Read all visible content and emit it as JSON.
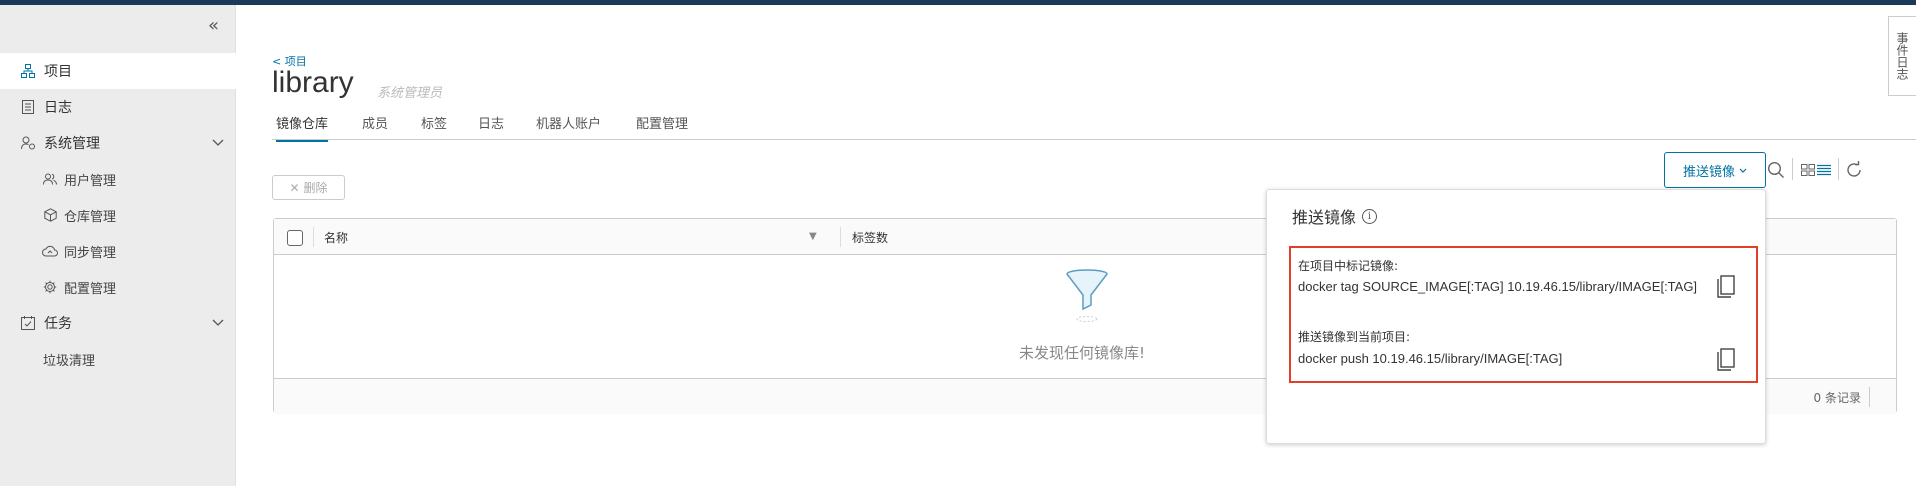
{
  "sidebar": {
    "items": [
      {
        "label": "项目",
        "icon": "project-icon"
      },
      {
        "label": "日志",
        "icon": "log-icon"
      },
      {
        "label": "系统管理",
        "icon": "admin-icon"
      },
      {
        "label": "任务",
        "icon": "task-icon"
      }
    ],
    "admin_sub": [
      {
        "label": "用户管理",
        "icon": "users-icon"
      },
      {
        "label": "仓库管理",
        "icon": "cube-icon"
      },
      {
        "label": "同步管理",
        "icon": "cloud-icon"
      },
      {
        "label": "配置管理",
        "icon": "gear-icon"
      }
    ],
    "task_sub": [
      {
        "label": "垃圾清理"
      }
    ]
  },
  "header": {
    "breadcrumb": "< 项目",
    "title": "library",
    "role": "系统管理员"
  },
  "tabs": [
    "镜像仓库",
    "成员",
    "标签",
    "日志",
    "机器人账户",
    "配置管理"
  ],
  "toolbar": {
    "delete_label": "删除",
    "push_label": "推送镜像"
  },
  "grid": {
    "columns": [
      "名称",
      "标签数"
    ],
    "empty_text": "未发现任何镜像库!",
    "record_count": "0 条记录"
  },
  "popover": {
    "title": "推送镜像",
    "tag_label": "在项目中标记镜像:",
    "tag_command": "docker tag SOURCE_IMAGE[:TAG] 10.19.46.15/library/IMAGE[:TAG]",
    "push_label": "推送镜像到当前项目:",
    "push_command": "docker push 10.19.46.15/library/IMAGE[:TAG]"
  },
  "side_tab": "事件日志",
  "colors": {
    "accent": "#0072a3",
    "highlight_border": "#e0402a",
    "topbar": "#1b3a57",
    "sidebar_bg": "#ececec"
  }
}
